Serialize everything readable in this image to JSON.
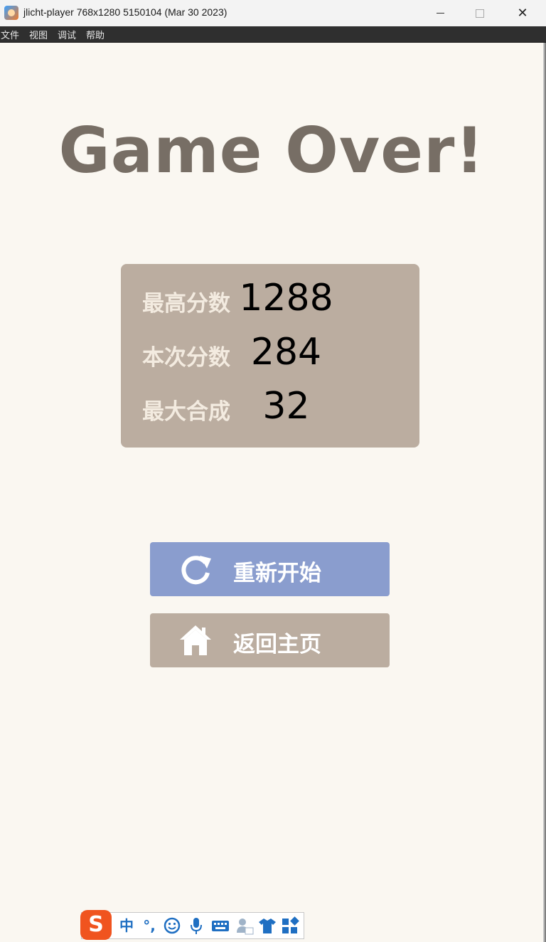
{
  "window": {
    "title": "jlicht-player 768x1280 5150104 (Mar 30 2023)",
    "minimize_icon": "minimize-icon",
    "maximize_icon": "maximize-icon",
    "close_icon": "close-icon",
    "close_glyph": "✕"
  },
  "menu": [
    "文件",
    "视图",
    "调试",
    "帮助"
  ],
  "game": {
    "heading": "Game Over!",
    "scores": [
      {
        "label": "最高分数",
        "value": "1288"
      },
      {
        "label": "本次分数",
        "value": "284"
      },
      {
        "label": "最大合成",
        "value": "32"
      }
    ],
    "buttons": {
      "restart": {
        "label": "重新开始",
        "icon": "refresh-icon"
      },
      "home": {
        "label": "返回主页",
        "icon": "home-icon"
      }
    },
    "colors": {
      "background": "#faf7f1",
      "heading": "#776e65",
      "panel": "#bbada0",
      "restart_button": "#8a9dce",
      "home_button": "#bbada0"
    }
  },
  "ime_toolbar": {
    "logo": "S",
    "mode": "中",
    "punct": "°,",
    "items": [
      "emoji-icon",
      "microphone-icon",
      "keyboard-icon",
      "user-icon",
      "skin-icon",
      "grid-icon"
    ]
  }
}
